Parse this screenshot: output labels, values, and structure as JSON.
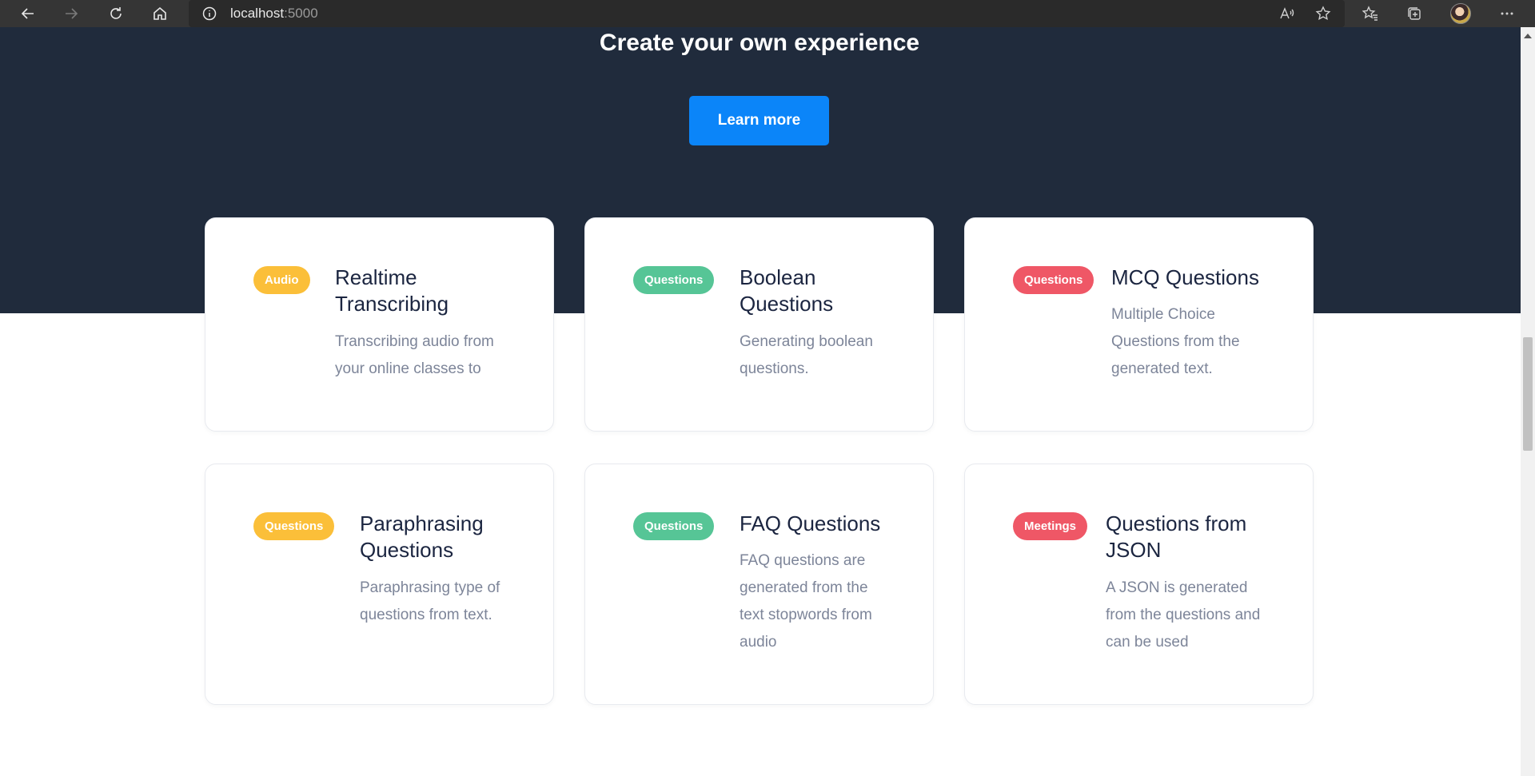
{
  "browser": {
    "url_host": "localhost",
    "url_port": ":5000"
  },
  "hero": {
    "title": "Create your own experience",
    "button_label": "Learn more"
  },
  "colors": {
    "hero_bg": "#202b3c",
    "button": "#0b85f9",
    "badge_yellow": "#fbbf39",
    "badge_green": "#56c596",
    "badge_red": "#ef5766",
    "card_title": "#1b2540",
    "card_desc": "#7d8599"
  },
  "cards": [
    {
      "badge": "Audio",
      "title": "Realtime Transcribing",
      "description": "Transcribing audio from your online classes to"
    },
    {
      "badge": "Questions",
      "title": "Boolean Questions",
      "description": "Generating boolean questions."
    },
    {
      "badge": "Questions",
      "title": "MCQ Questions",
      "description": "Multiple Choice Questions from the generated text."
    },
    {
      "badge": "Questions",
      "title": "Paraphrasing Questions",
      "description": "Paraphrasing type of questions from text."
    },
    {
      "badge": "Questions",
      "title": "FAQ Questions",
      "description": "FAQ questions are generated from the text stopwords from audio"
    },
    {
      "badge": "Meetings",
      "title": "Questions from JSON",
      "description": "A JSON is generated from the questions and can be used"
    }
  ]
}
